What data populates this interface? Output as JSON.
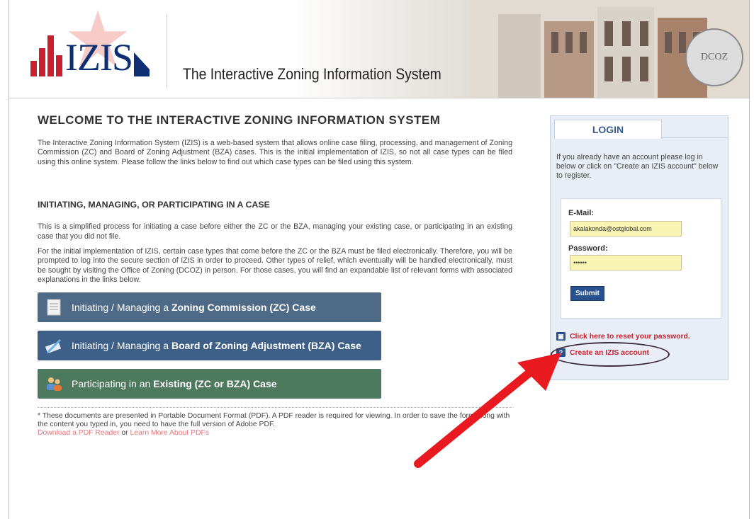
{
  "header": {
    "logo_text": "IZIS",
    "site_title": "The Interactive Zoning Information System",
    "seal_text": "DCOZ"
  },
  "main": {
    "welcome_title": "WELCOME TO THE INTERACTIVE ZONING INFORMATION SYSTEM",
    "intro": "The Interactive Zoning Information System (IZIS) is a web-based system that allows online case filing, processing, and management of Zoning Commission (ZC) and Board of Zoning Adjustment (BZA) cases. This is the initial implementation of IZIS, so not all case types can be filed using this online system. Please follow the links below to find out which case types can be filed using this system.",
    "section_title": "INITIATING, MANAGING, OR PARTICIPATING IN A CASE",
    "para1": "This is a simplified process for initiating a case before either the ZC or the BZA, managing your existing case, or participating in an existing case that you did not file.",
    "para2": "For the initial implementation of IZIS, certain case types that come before the ZC or the BZA must be filed electronically. Therefore, you will be prompted to log into the secure section of IZIS in order to proceed. Other types of relief, which eventually will be handled electronically, must be sought by visiting the Office of Zoning (DCOZ) in person. For those cases, you will find an expandable list of relevant forms with associated explanations in the links below.",
    "buttons": [
      {
        "prefix": "Initiating / Managing a",
        "bold": "Zoning Commission (ZC) Case",
        "icon": "document-icon"
      },
      {
        "prefix": "Initiating / Managing a",
        "bold": "Board of Zoning Adjustment (BZA) Case",
        "icon": "pen-icon"
      },
      {
        "prefix": "Participating in an",
        "bold": "Existing (ZC or BZA) Case",
        "icon": "people-icon"
      }
    ],
    "footnote": "* These documents are presented in Portable Document Format (PDF). A PDF reader is required for viewing. In order to save the form along with the content you typed in, you need to have the full version of Adobe PDF.",
    "link_download": "Download a PDF Reader",
    "link_or": " or ",
    "link_learn": "Learn More About PDFs"
  },
  "login": {
    "tab_label": "LOGIN",
    "intro": "If you already have an account please log in below or click on \"Create an IZIS account\" below to register.",
    "email_label": "E-Mail:",
    "email_value": "akalakonda@ostglobal.com",
    "password_label": "Password:",
    "password_value": "••••••",
    "submit_label": "Submit",
    "reset_link": "Click here to reset your password.",
    "create_link": "Create an IZIS account"
  },
  "colors": {
    "brand_navy": "#0e2f73",
    "brand_red": "#c8202e",
    "annotation_arrow": "#e8191f"
  }
}
